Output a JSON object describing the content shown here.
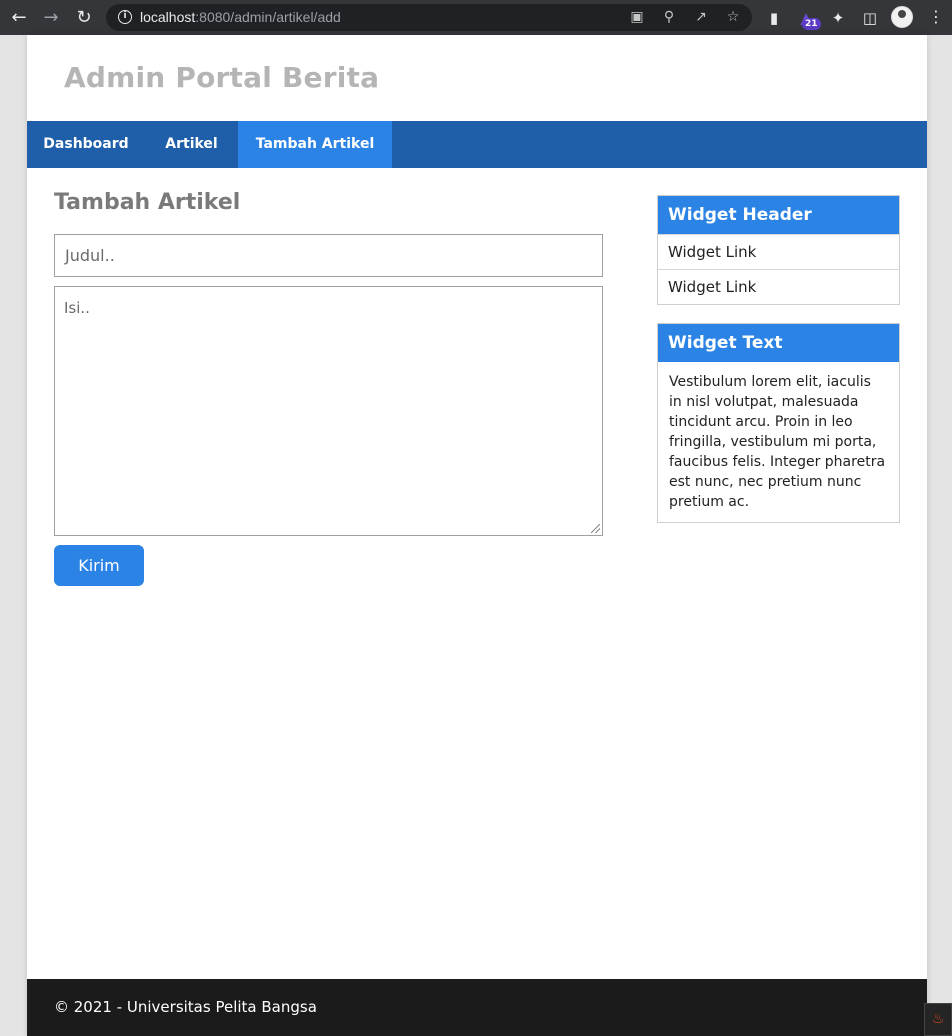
{
  "browser": {
    "url_host": "localhost",
    "url_path": ":8080/admin/artikel/add",
    "extension_badge": "21"
  },
  "site": {
    "title": "Admin Portal Berita"
  },
  "nav": {
    "items": [
      {
        "label": "Dashboard"
      },
      {
        "label": "Artikel"
      },
      {
        "label": "Tambah Artikel"
      }
    ],
    "active": "Tambah Artikel"
  },
  "form": {
    "heading": "Tambah Artikel",
    "judul_placeholder": "Judul..",
    "isi_placeholder": "Isi..",
    "submit_label": "Kirim"
  },
  "widgets": {
    "links_widget": {
      "header": "Widget Header",
      "links": [
        "Widget Link",
        "Widget Link"
      ]
    },
    "text_widget": {
      "header": "Widget Text",
      "body": "Vestibulum lorem elit, iaculis in nisl volutpat, malesuada tincidunt arcu. Proin in leo fringilla, vestibulum mi porta, faucibus felis. Integer pharetra est nunc, nec pretium nunc pretium ac."
    }
  },
  "footer": {
    "text": "© 2021 - Universitas Pelita Bangsa"
  },
  "colors": {
    "navbar": "#1f5faa",
    "accent": "#2b83e5",
    "footer": "#1b1b1b"
  }
}
